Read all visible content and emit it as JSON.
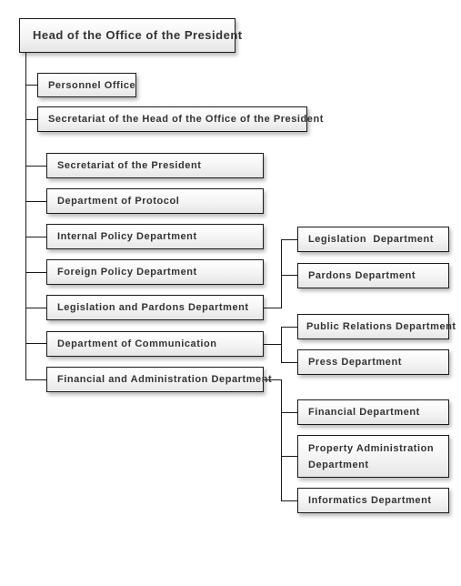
{
  "chart": {
    "root": "Head of the Office of the President",
    "level1": [
      "Personnel Office",
      "Secretariat of the Head of the Office of the President"
    ],
    "level2": [
      "Secretariat of the President",
      "Department of Protocol",
      "Internal Policy Department",
      "Foreign Policy Department",
      "Legislation and Pardons Department",
      "Department of Communication",
      "Financial and Administration Department"
    ],
    "legislation_children": [
      "Legislation  Department",
      "Pardons Department"
    ],
    "communication_children": [
      "Public Relations Department",
      "Press Department"
    ],
    "financial_children": [
      "Financial Department",
      "Property Administration Department",
      "Informatics Department"
    ]
  }
}
